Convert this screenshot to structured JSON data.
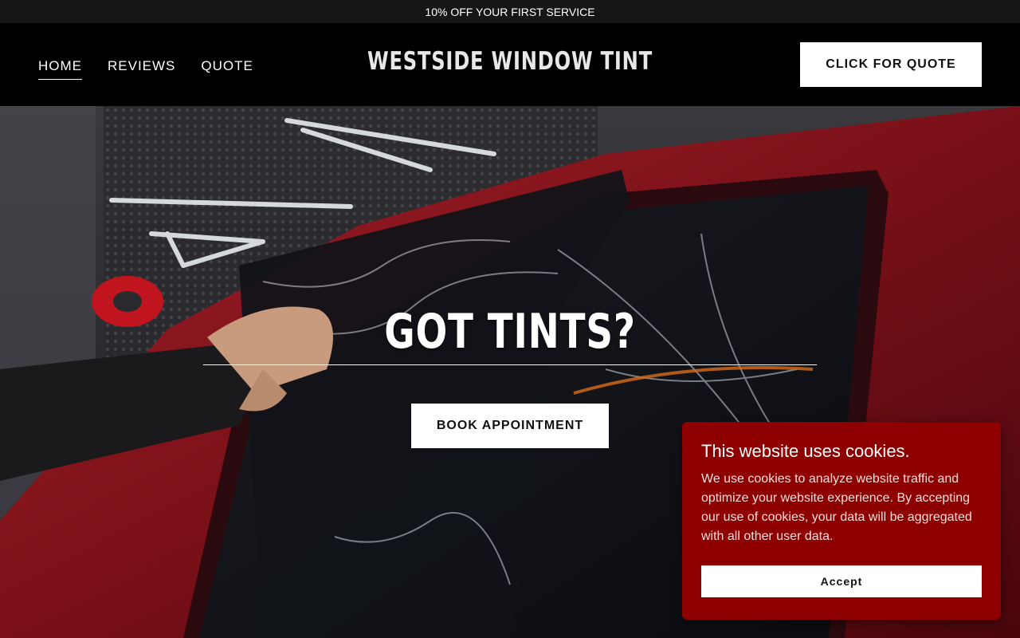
{
  "promo": {
    "text": "10% OFF YOUR FIRST SERVICE"
  },
  "header": {
    "nav": [
      {
        "label": "HOME",
        "active": true
      },
      {
        "label": "REVIEWS",
        "active": false
      },
      {
        "label": "QUOTE",
        "active": false
      }
    ],
    "site_title": "WESTSIDE WINDOW TINT",
    "cta_label": "CLICK FOR QUOTE"
  },
  "hero": {
    "title": "GOT TINTS?",
    "button_label": "BOOK APPOINTMENT"
  },
  "cookie_banner": {
    "title": "This website uses cookies.",
    "text": "We use cookies to analyze website traffic and optimize your website experience. By accepting our use of cookies, your data will be aggregated with all other user data.",
    "accept_label": "Accept",
    "background_color": "#8e0000"
  }
}
